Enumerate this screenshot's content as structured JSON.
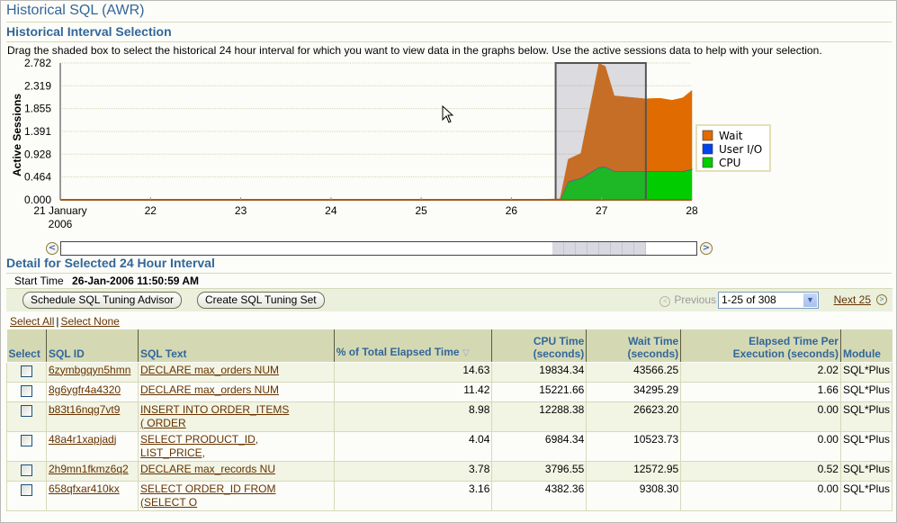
{
  "page": {
    "title": "Historical SQL (AWR)",
    "interval_section_title": "Historical Interval Selection",
    "instructions": "Drag the shaded box to select the historical 24 hour interval for which you want to view data in the graphs below. Use the active sessions data to help with your selection.",
    "detail_section_title": "Detail for Selected 24 Hour Interval",
    "start_time_label": "Start Time",
    "start_time_value": "26-Jan-2006 11:50:59 AM"
  },
  "chart_data": {
    "type": "area",
    "stacked": true,
    "title": "",
    "xlabel": "",
    "ylabel": "Active Sessions",
    "ylim": [
      0,
      2.782
    ],
    "yticks": [
      "0.000",
      "0.464",
      "0.928",
      "1.391",
      "1.855",
      "2.319",
      "2.782"
    ],
    "xlim": [
      21,
      28
    ],
    "xticks": [
      {
        "value": 21,
        "label": "21 January",
        "sublabel": "2006"
      },
      {
        "value": 22,
        "label": "22"
      },
      {
        "value": 23,
        "label": "23"
      },
      {
        "value": 24,
        "label": "24"
      },
      {
        "value": 25,
        "label": "25"
      },
      {
        "value": 26,
        "label": "26"
      },
      {
        "value": 27,
        "label": "27"
      },
      {
        "value": 28,
        "label": "28"
      }
    ],
    "grid": true,
    "legend": "right",
    "x": [
      21,
      26.3,
      26.54,
      26.63,
      26.77,
      26.97,
      27.04,
      27.14,
      27.48,
      27.65,
      27.78,
      27.9,
      28
    ],
    "series": [
      {
        "name": "CPU",
        "color": "#00cc00",
        "values": [
          0,
          0,
          0,
          0.37,
          0.44,
          0.66,
          0.67,
          0.58,
          0.58,
          0.58,
          0.58,
          0.58,
          0.62
        ]
      },
      {
        "name": "User I/O",
        "color": "#0044ee",
        "values": [
          0,
          0,
          0,
          0.005,
          0.005,
          0.005,
          0.005,
          0.005,
          0.005,
          0.005,
          0.005,
          0.005,
          0.005
        ]
      },
      {
        "name": "Wait",
        "color": "#e06b00",
        "values": [
          0.005,
          0.01,
          0.02,
          0.45,
          0.5,
          2.11,
          2.04,
          1.53,
          1.47,
          1.48,
          1.44,
          1.49,
          1.6
        ]
      }
    ],
    "selection": {
      "start": 26.49,
      "end": 27.49
    }
  },
  "scrollbar": {
    "prev_icon": "scroll-left-icon",
    "next_icon": "scroll-right-icon",
    "window_start_fraction": 0.773,
    "window_end_fraction": 0.92
  },
  "toolbar": {
    "schedule_label": "Schedule SQL Tuning Advisor",
    "create_set_label": "Create SQL Tuning Set"
  },
  "pager": {
    "previous_label": "Previous",
    "range_selected": "1-25 of 308",
    "next_label": "Next 25"
  },
  "select_links": {
    "select_all": "Select All",
    "separator": "|",
    "select_none": "Select None"
  },
  "table": {
    "columns": [
      {
        "label": "Select"
      },
      {
        "label": "SQL ID"
      },
      {
        "label": "SQL Text"
      },
      {
        "label": "% of Total Elapsed Time",
        "sorted": "desc"
      },
      {
        "label": "CPU Time",
        "label2": "(seconds)"
      },
      {
        "label": "Wait Time",
        "label2": "(seconds)"
      },
      {
        "label": "Elapsed Time Per",
        "label2": "Execution (seconds)"
      },
      {
        "label": "Module"
      }
    ],
    "rows": [
      {
        "sql_id": "6zymbgqyn5hmn",
        "sql_text": [
          "DECLARE max_orders NUM"
        ],
        "pct_elapsed": "14.63",
        "cpu": "19834.34",
        "wait": "43566.25",
        "per_exec": "2.02",
        "module": "SQL*Plus"
      },
      {
        "sql_id": "8g6ygfr4a4320",
        "sql_text": [
          "DECLARE max_orders NUM"
        ],
        "pct_elapsed": "11.42",
        "cpu": "15221.66",
        "wait": "34295.29",
        "per_exec": "1.66",
        "module": "SQL*Plus"
      },
      {
        "sql_id": "b83t16nqg7vt9",
        "sql_text": [
          "INSERT INTO ORDER_ITEMS",
          "( ORDER"
        ],
        "pct_elapsed": "8.98",
        "cpu": "12288.38",
        "wait": "26623.20",
        "per_exec": "0.00",
        "module": "SQL*Plus"
      },
      {
        "sql_id": "48a4r1xapjadj",
        "sql_text": [
          "SELECT PRODUCT_ID,",
          "LIST_PRICE,"
        ],
        "pct_elapsed": "4.04",
        "cpu": "6984.34",
        "wait": "10523.73",
        "per_exec": "0.00",
        "module": "SQL*Plus"
      },
      {
        "sql_id": "2h9mn1fkmz6q2",
        "sql_text": [
          "DECLARE max_records NU"
        ],
        "pct_elapsed": "3.78",
        "cpu": "3796.55",
        "wait": "12572.95",
        "per_exec": "0.52",
        "module": "SQL*Plus"
      },
      {
        "sql_id": "658qfxar410kx",
        "sql_text": [
          "SELECT ORDER_ID FROM",
          "(SELECT O"
        ],
        "pct_elapsed": "3.16",
        "cpu": "4382.36",
        "wait": "9308.30",
        "per_exec": "0.00",
        "module": "SQL*Plus"
      }
    ]
  }
}
